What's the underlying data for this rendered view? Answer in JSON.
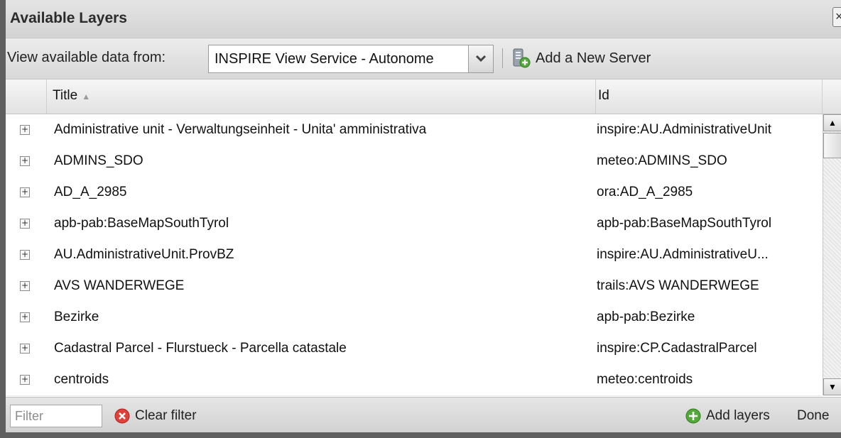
{
  "window": {
    "title": "Available Layers"
  },
  "toolbar": {
    "label": "View available data from:",
    "server_value": "INSPIRE View Service - Autonome",
    "add_server_label": "Add a New Server"
  },
  "grid": {
    "columns": {
      "title": "Title",
      "id": "Id"
    },
    "sort_indicator": "▲",
    "expander_glyph": "+",
    "rows": [
      {
        "title": "Administrative unit - Verwaltungseinheit - Unita' amministrativa",
        "id": "inspire:AU.AdministrativeUnit"
      },
      {
        "title": "ADMINS_SDO",
        "id": "meteo:ADMINS_SDO"
      },
      {
        "title": "AD_A_2985",
        "id": "ora:AD_A_2985"
      },
      {
        "title": "apb-pab:BaseMapSouthTyrol",
        "id": "apb-pab:BaseMapSouthTyrol"
      },
      {
        "title": "AU.AdministrativeUnit.ProvBZ",
        "id": "inspire:AU.AdministrativeU..."
      },
      {
        "title": "AVS WANDERWEGE",
        "id": "trails:AVS WANDERWEGE"
      },
      {
        "title": "Bezirke",
        "id": "apb-pab:Bezirke"
      },
      {
        "title": "Cadastral Parcel - Flurstueck - Parcella catastale",
        "id": "inspire:CP.CadastralParcel"
      },
      {
        "title": "centroids",
        "id": "meteo:centroids"
      }
    ]
  },
  "footer": {
    "filter_placeholder": "Filter",
    "clear_filter_label": "Clear filter",
    "add_layers_label": "Add layers",
    "done_label": "Done"
  },
  "colors": {
    "clear_icon": "#e0403a",
    "add_icon": "#52a93a"
  }
}
